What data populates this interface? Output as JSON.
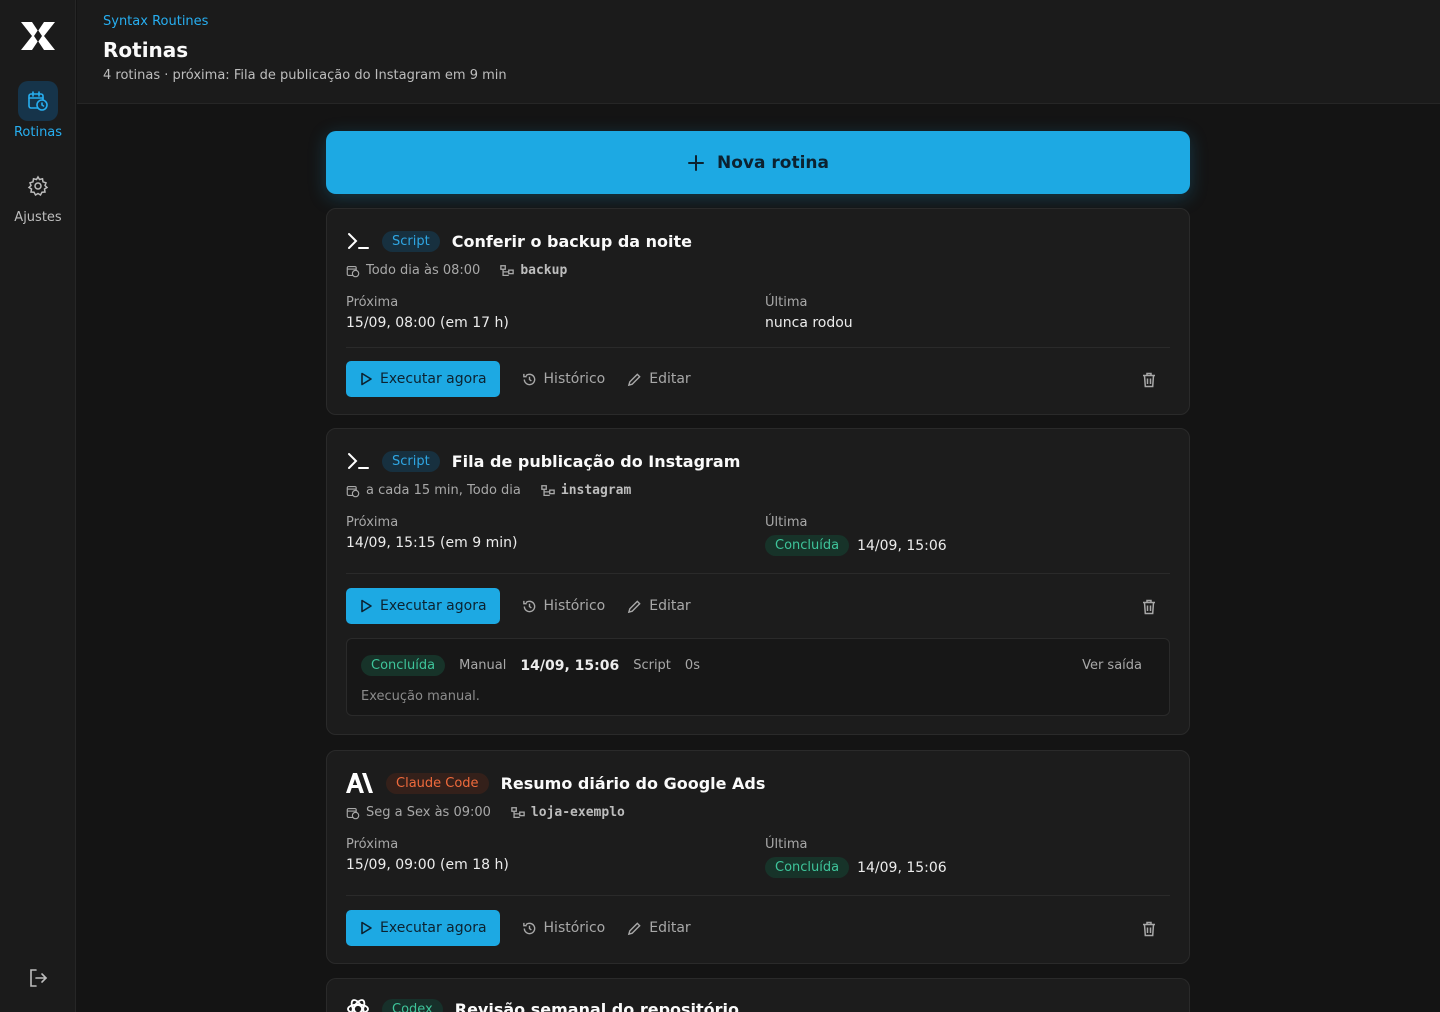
{
  "sidebar": {
    "logo_icon": "x-logo-icon",
    "items": [
      {
        "label": "Rotinas",
        "icon": "calendar-clock-icon",
        "active": true
      },
      {
        "label": "Ajustes",
        "icon": "gear-icon",
        "active": false
      }
    ],
    "logout_icon": "logout-icon"
  },
  "header": {
    "brand": "Syntax Routines",
    "title": "Rotinas",
    "subtitle": "4 rotinas · próxima: Fila de publicação do Instagram em 9 min"
  },
  "new_button": {
    "label": "Nova rotina",
    "icon": "plus-icon"
  },
  "labels": {
    "next": "Próxima",
    "last": "Última",
    "run": "Executar agora",
    "history": "Histórico",
    "edit": "Editar"
  },
  "routines": [
    {
      "type": "Script",
      "type_icon": "terminal-icon",
      "title": "Conferir o backup da noite",
      "schedule": "Todo dia às 08:00",
      "repo": "backup",
      "next": "15/09, 08:00 (em 17 h)",
      "last_status": "",
      "last_time": "nunca rodou"
    },
    {
      "type": "Script",
      "type_icon": "terminal-icon",
      "title": "Fila de publicação do Instagram",
      "schedule": "a cada 15 min, Todo dia",
      "repo": "instagram",
      "next": "14/09, 15:15 (em 9 min)",
      "last_status": "Concluída",
      "last_time": "14/09, 15:06",
      "execution": {
        "status": "Concluída",
        "trigger": "Manual",
        "when": "14/09, 15:06",
        "kind": "Script",
        "duration": "0s",
        "see_output": "Ver saída",
        "note": "Execução manual."
      }
    },
    {
      "type": "Claude Code",
      "type_icon": "anthropic-icon",
      "title": "Resumo diário do Google Ads",
      "schedule": "Seg a Sex às 09:00",
      "repo": "loja-exemplo",
      "next": "15/09, 09:00 (em 18 h)",
      "last_status": "Concluída",
      "last_time": "14/09, 15:06"
    },
    {
      "type": "Codex",
      "type_icon": "openai-icon",
      "title": "Revisão semanal do repositório"
    }
  ],
  "colors": {
    "accent": "#1da9e3",
    "success": "#3ec49a",
    "claude": "#ef6a3c"
  }
}
